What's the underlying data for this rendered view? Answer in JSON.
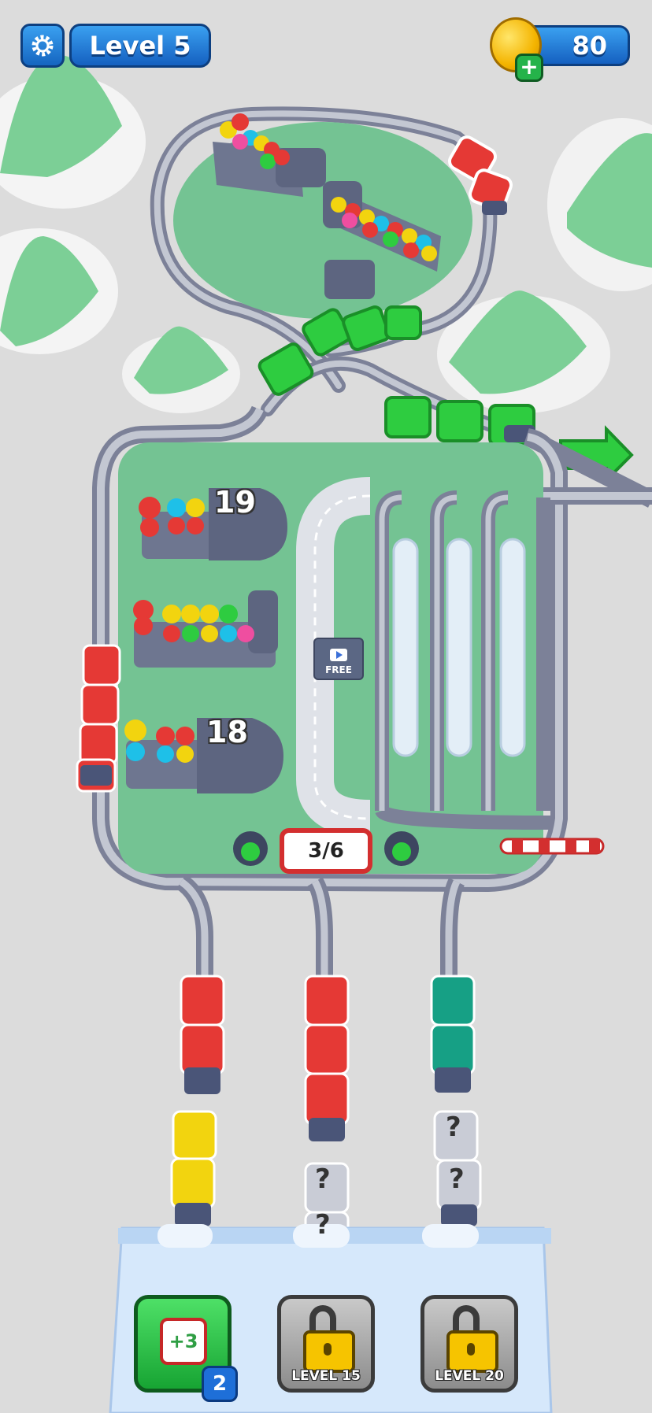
{
  "hud": {
    "level_label": "Level 5",
    "coins": "80",
    "coin_add_label": "+",
    "settings_icon": "gear-icon"
  },
  "station": {
    "bench_top_count": "19",
    "bench_bottom_count": "18",
    "progress": "3/6",
    "free_label": "FREE"
  },
  "boosters": [
    {
      "label": "+3",
      "count": "2",
      "locked": false
    },
    {
      "label": "LEVEL 15",
      "locked": true
    },
    {
      "label": "LEVEL 20",
      "locked": true
    }
  ],
  "hidden_car_mark": "?",
  "colors": {
    "background": "#dcdcdc",
    "grass": "#74c393",
    "track": "#8a90a4",
    "hud_blue": "#1e78d8",
    "train_red": "#e53935",
    "train_green": "#2ecc40",
    "train_yellow": "#f2d40f",
    "train_teal": "#16a085"
  }
}
